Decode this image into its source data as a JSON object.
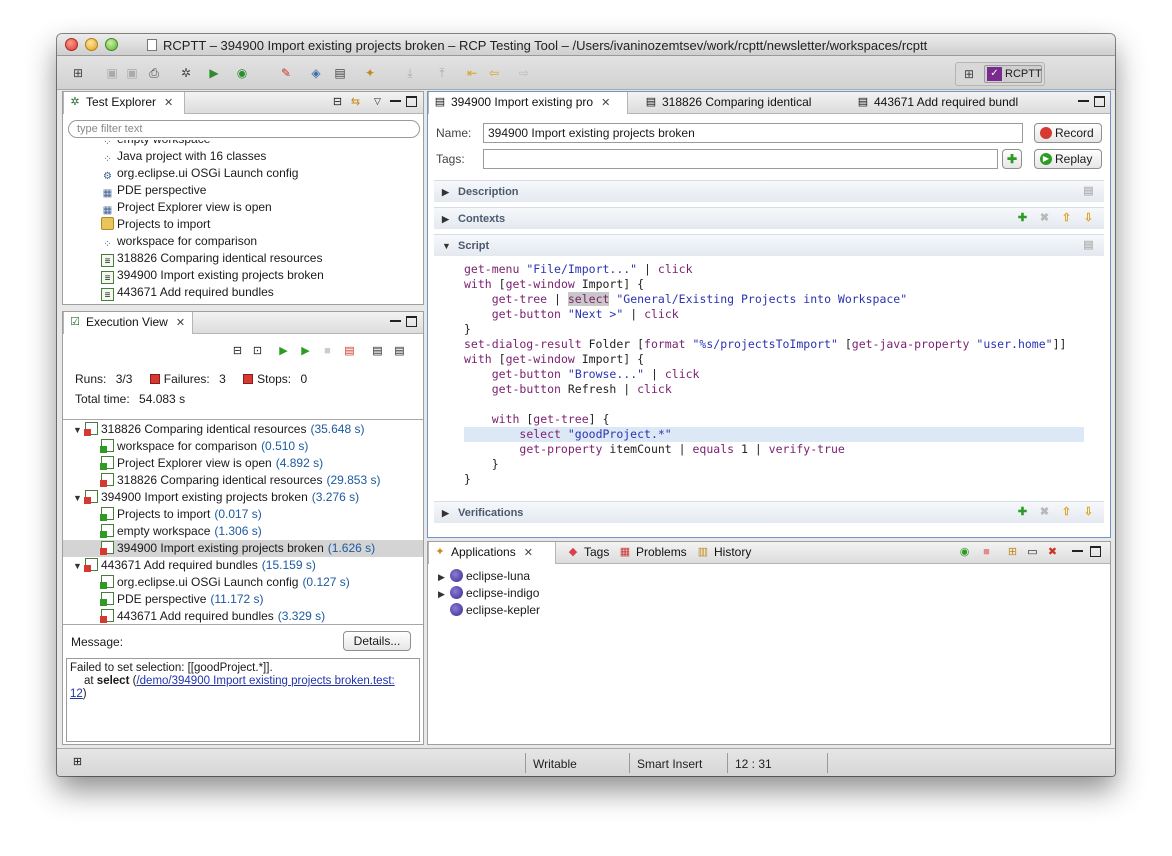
{
  "window": {
    "title": "RCPTT – 394900 Import existing projects broken – RCP Testing Tool – /Users/ivaninozemtsev/work/rcptt/newsletter/workspaces/rcptt"
  },
  "perspective": {
    "label": "RCPTT"
  },
  "test_explorer": {
    "tab_label": "Test Explorer",
    "filter_placeholder": "type filter text",
    "items": [
      {
        "label": "empty workspace",
        "icon": "context-icon"
      },
      {
        "label": "Java project with 16 classes",
        "icon": "context-icon"
      },
      {
        "label": "org.eclipse.ui OSGi Launch config",
        "icon": "gear-icon"
      },
      {
        "label": "PDE perspective",
        "icon": "perspective-icon"
      },
      {
        "label": "Project Explorer view is open",
        "icon": "perspective-icon"
      },
      {
        "label": "Projects to import",
        "icon": "folder-icon"
      },
      {
        "label": "workspace for comparison",
        "icon": "context-icon"
      },
      {
        "label": "318826 Comparing identical resources",
        "icon": "test-icon"
      },
      {
        "label": "394900 Import existing projects broken",
        "icon": "test-icon"
      },
      {
        "label": "443671 Add required bundles",
        "icon": "test-icon"
      }
    ]
  },
  "execution_view": {
    "tab_label": "Execution View",
    "runs_label": "Runs:",
    "runs_value": "3/3",
    "failures_label": "Failures:",
    "failures_value": "3",
    "stops_label": "Stops:",
    "stops_value": "0",
    "total_time_label": "Total time:",
    "total_time_value": "54.083 s",
    "results": [
      {
        "label": "318826 Comparing identical resources",
        "duration": "(35.648 s)",
        "level": 0,
        "expanded": true
      },
      {
        "label": "workspace for comparison",
        "duration": "(0.510 s)",
        "level": 1
      },
      {
        "label": "Project Explorer view is open",
        "duration": "(4.892 s)",
        "level": 1
      },
      {
        "label": "318826 Comparing identical resources",
        "duration": "(29.853 s)",
        "level": 1,
        "failed": true
      },
      {
        "label": "394900 Import existing projects broken",
        "duration": "(3.276 s)",
        "level": 0,
        "expanded": true
      },
      {
        "label": "Projects to import",
        "duration": "(0.017 s)",
        "level": 1
      },
      {
        "label": "empty workspace",
        "duration": "(1.306 s)",
        "level": 1
      },
      {
        "label": "394900 Import existing projects broken",
        "duration": "(1.626 s)",
        "level": 1,
        "failed": true,
        "selected": true
      },
      {
        "label": "443671 Add required bundles",
        "duration": "(15.159 s)",
        "level": 0,
        "expanded": true
      },
      {
        "label": "org.eclipse.ui OSGi Launch config",
        "duration": "(0.127 s)",
        "level": 1
      },
      {
        "label": "PDE perspective",
        "duration": "(11.172 s)",
        "level": 1
      },
      {
        "label": "443671 Add required bundles",
        "duration": "(3.329 s)",
        "level": 1,
        "failed": true
      }
    ],
    "message_label": "Message:",
    "details_button": "Details...",
    "message_line1": "Failed to set selection: [[goodProject.*]].",
    "message_at": "at",
    "message_select": "select",
    "message_link": "/demo/394900 Import existing projects broken.test:",
    "message_link_tail": "12",
    "message_paren_open": "(",
    "message_paren_close": ")"
  },
  "editor": {
    "tabs": [
      {
        "label": "394900 Import existing pro",
        "active": true
      },
      {
        "label": "318826 Comparing identical"
      },
      {
        "label": "443671 Add required bundl"
      }
    ],
    "name_label": "Name:",
    "name_value": "394900 Import existing projects broken",
    "tags_label": "Tags:",
    "tags_value": "",
    "record_button": "Record",
    "replay_button": "Replay",
    "sections": {
      "description": "Description",
      "contexts": "Contexts",
      "script": "Script",
      "verifications": "Verifications"
    }
  },
  "bottom_panel": {
    "tabs": [
      "Applications",
      "Tags",
      "Problems",
      "History"
    ],
    "applications": [
      {
        "label": "eclipse-luna",
        "expandable": true
      },
      {
        "label": "eclipse-indigo",
        "expandable": true
      },
      {
        "label": "eclipse-kepler",
        "expandable": false
      }
    ]
  },
  "status_bar": {
    "writable": "Writable",
    "insert_mode": "Smart Insert",
    "position": "12 : 31"
  }
}
